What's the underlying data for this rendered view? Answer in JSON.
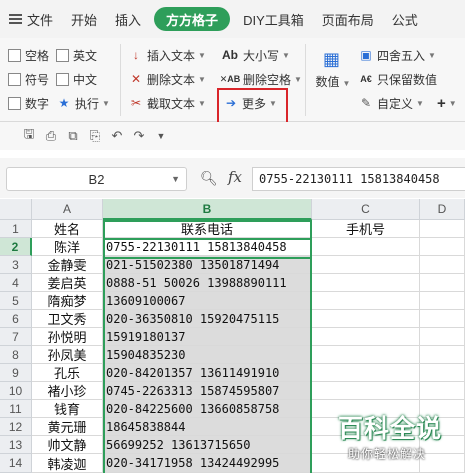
{
  "menu": {
    "file": "文件",
    "tabs": [
      "开始",
      "插入",
      "方方格子",
      "DIY工具箱",
      "页面布局",
      "公式"
    ],
    "active_tab": "方方格子"
  },
  "ribbon": {
    "checks": {
      "space": "空格",
      "english": "英文",
      "symbol": "符号",
      "chinese": "中文",
      "number": "数字",
      "execute": "执行"
    },
    "text": {
      "insert": "插入文本",
      "delete": "删除文本",
      "extract": "截取文本",
      "more": "更多"
    },
    "case": {
      "upper_lower": "大小写",
      "delete_space": "删除空格"
    },
    "numeric": {
      "values": "数值",
      "round": "四舍五入",
      "keep_values": "只保留数值",
      "custom": "自定义",
      "plus": "+"
    }
  },
  "formula_bar": {
    "name_box": "B2",
    "fx": "fx",
    "value": "0755-22130111 15813840458"
  },
  "columns": [
    "A",
    "B",
    "C",
    "D"
  ],
  "rows": [
    "1",
    "2",
    "3",
    "4",
    "5",
    "6",
    "7",
    "8",
    "9",
    "10",
    "11",
    "12",
    "13",
    "14"
  ],
  "header_row": {
    "a": "姓名",
    "b": "联系电话",
    "c": "手机号"
  },
  "data": [
    {
      "name": "陈洋",
      "phone": "0755-22130111 15813840458"
    },
    {
      "name": "金静雯",
      "phone": "021-51502380 13501871494"
    },
    {
      "name": "姜启英",
      "phone": "0888-51 50026 13988890111"
    },
    {
      "name": "隋痴梦",
      "phone": "13609100067"
    },
    {
      "name": "卫文秀",
      "phone": "020-36350810 15920475115"
    },
    {
      "name": "孙悦明",
      "phone": "15919180137"
    },
    {
      "name": "孙凤美",
      "phone": "15904835230"
    },
    {
      "name": "孔乐",
      "phone": "020-84201357 13611491910"
    },
    {
      "name": "褚小珍",
      "phone": "0745-2263313 15874595807"
    },
    {
      "name": "钱育",
      "phone": "020-84225600 13660858758"
    },
    {
      "name": "黄元珊",
      "phone": "18645838844"
    },
    {
      "name": "帅文静",
      "phone": "56699252 13613715650"
    },
    {
      "name": "韩凌迦",
      "phone": "020-34171958 13424492995"
    }
  ],
  "watermark": {
    "title": "百科全说",
    "subtitle": "助你轻松解决"
  },
  "colors": {
    "accent": "#2e9e5a",
    "highlight": "#d9252a"
  }
}
